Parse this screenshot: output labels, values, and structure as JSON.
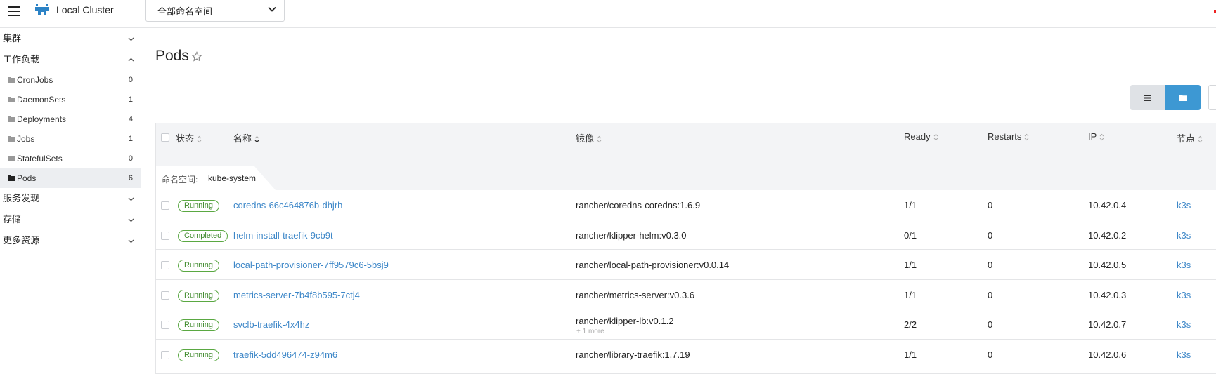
{
  "header": {
    "cluster_name": "Local Cluster",
    "namespace_select": "全部命名空间"
  },
  "sidebar": {
    "groups": [
      {
        "label": "集群",
        "expanded": false
      },
      {
        "label": "工作负载",
        "expanded": true
      },
      {
        "label": "服务发现",
        "expanded": false
      },
      {
        "label": "存储",
        "expanded": false
      },
      {
        "label": "更多资源",
        "expanded": false
      }
    ],
    "workload_items": [
      {
        "label": "CronJobs",
        "count": "0"
      },
      {
        "label": "DaemonSets",
        "count": "1"
      },
      {
        "label": "Deployments",
        "count": "4"
      },
      {
        "label": "Jobs",
        "count": "1"
      },
      {
        "label": "StatefulSets",
        "count": "0"
      },
      {
        "label": "Pods",
        "count": "6",
        "active": true
      }
    ]
  },
  "main": {
    "title": "Pods",
    "columns": {
      "status": "状态",
      "name": "名称",
      "image": "镜像",
      "ready": "Ready",
      "restarts": "Restarts",
      "ip": "IP",
      "node": "节点"
    },
    "group": {
      "label": "命名空间:",
      "value": "kube-system"
    },
    "rows": [
      {
        "status": "Running",
        "name": "coredns-66c464876b-dhjrh",
        "image": "rancher/coredns-coredns:1.6.9",
        "more": "",
        "ready": "1/1",
        "restarts": "0",
        "ip": "10.42.0.4",
        "node": "k3s"
      },
      {
        "status": "Completed",
        "name": "helm-install-traefik-9cb9t",
        "image": "rancher/klipper-helm:v0.3.0",
        "more": "",
        "ready": "0/1",
        "restarts": "0",
        "ip": "10.42.0.2",
        "node": "k3s"
      },
      {
        "status": "Running",
        "name": "local-path-provisioner-7ff9579c6-5bsj9",
        "image": "rancher/local-path-provisioner:v0.0.14",
        "more": "",
        "ready": "1/1",
        "restarts": "0",
        "ip": "10.42.0.5",
        "node": "k3s"
      },
      {
        "status": "Running",
        "name": "metrics-server-7b4f8b595-7ctj4",
        "image": "rancher/metrics-server:v0.3.6",
        "more": "",
        "ready": "1/1",
        "restarts": "0",
        "ip": "10.42.0.3",
        "node": "k3s"
      },
      {
        "status": "Running",
        "name": "svclb-traefik-4x4hz",
        "image": "rancher/klipper-lb:v0.1.2",
        "more": "+ 1 more",
        "ready": "2/2",
        "restarts": "0",
        "ip": "10.42.0.7",
        "node": "k3s"
      },
      {
        "status": "Running",
        "name": "traefik-5dd496474-z94m6",
        "image": "rancher/library-traefik:1.7.19",
        "more": "",
        "ready": "1/1",
        "restarts": "0",
        "ip": "10.42.0.6",
        "node": "k3s"
      }
    ]
  },
  "colors": {
    "accent": "#3d98d3",
    "link": "#3d87c8",
    "status_green": "#5aa842"
  }
}
